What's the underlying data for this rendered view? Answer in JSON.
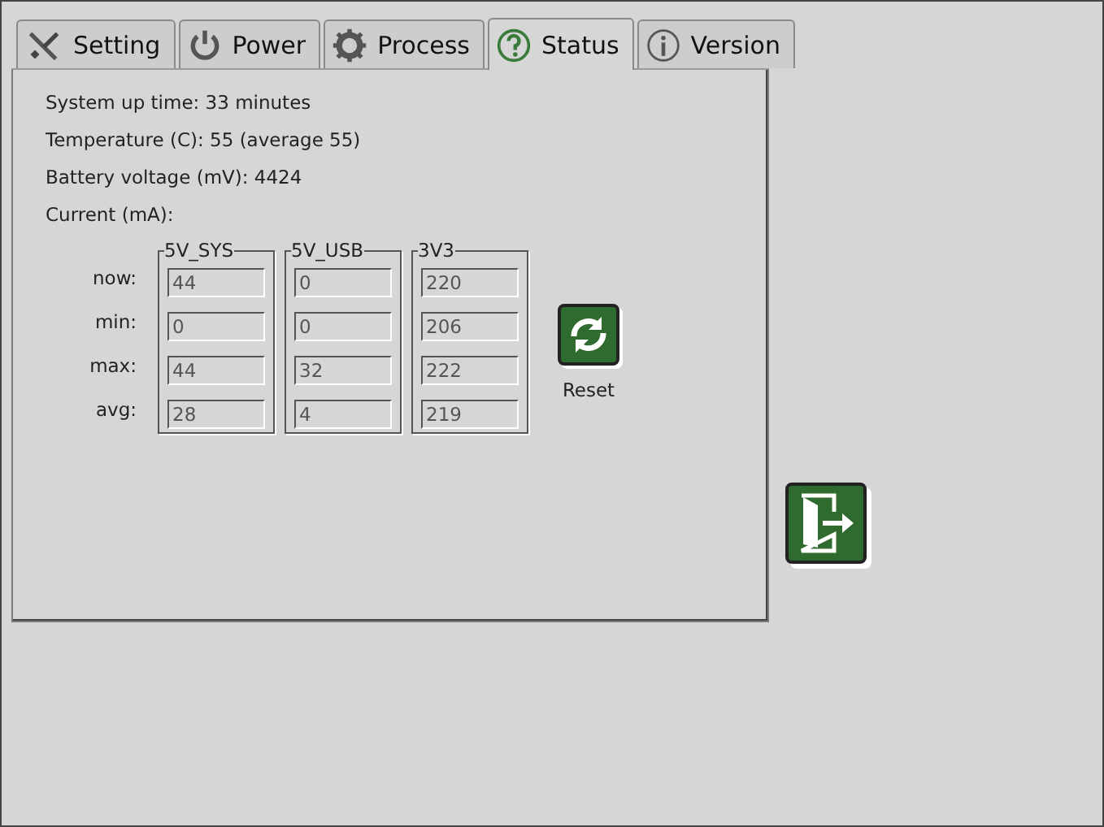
{
  "tabs": [
    {
      "label": "Setting",
      "selected": false
    },
    {
      "label": "Power",
      "selected": false
    },
    {
      "label": "Process",
      "selected": false
    },
    {
      "label": "Status",
      "selected": true
    },
    {
      "label": "Version",
      "selected": false
    }
  ],
  "status_lines": [
    "System up time:  33 minutes",
    "Temperature (C):  55 (average 55)",
    "Battery voltage (mV):  4424",
    "Current (mA):"
  ],
  "row_labels": [
    "now:",
    "min:",
    "max:",
    "avg:"
  ],
  "groups": [
    {
      "label": "5V_SYS",
      "values": [
        "44",
        "0",
        "44",
        "28"
      ]
    },
    {
      "label": "5V_USB",
      "values": [
        "0",
        "0",
        "32",
        "4"
      ]
    },
    {
      "label": "3V3",
      "values": [
        "220",
        "206",
        "222",
        "219"
      ]
    }
  ],
  "reset_button": {
    "label": "Reset"
  }
}
